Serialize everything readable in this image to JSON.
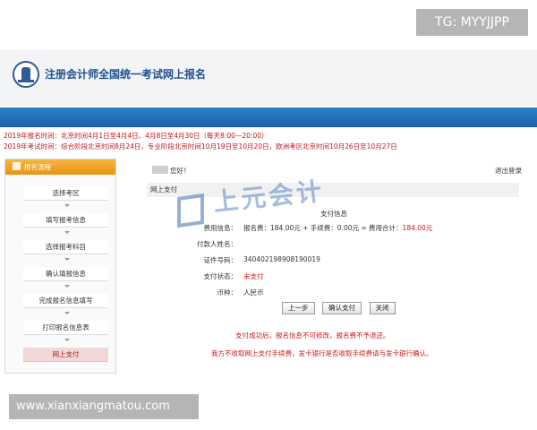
{
  "watermark_top": "TG: MYYJJPP",
  "watermark_bottom": "www.xianxiangmatou.com",
  "header": {
    "title": "注册会计师全国统一考试网上报名"
  },
  "notices": {
    "line1": "2019年报名时间：北京时间4月1日至4月4日、4月8日至4月30日（每天8:00—20:00）",
    "line2": "2019年考试时间：综合阶段北京时间8月24日，专业阶段北京时间10月19日至10月20日，欧洲考区北京时间10月26日至10月27日"
  },
  "sidebar": {
    "heading": "报名流程",
    "steps": [
      {
        "label": "选择考区",
        "active": false
      },
      {
        "label": "填写报考信息",
        "active": false
      },
      {
        "label": "选择报考科目",
        "active": false
      },
      {
        "label": "确认填报信息",
        "active": false
      },
      {
        "label": "完成报名信息填写",
        "active": false
      },
      {
        "label": "打印报名信息表",
        "active": false
      },
      {
        "label": "网上支付",
        "active": true
      }
    ]
  },
  "main": {
    "greeting": "您好！",
    "logout": "退出登录",
    "section": "网上支付",
    "pay_title": "支付信息",
    "fee_label": "费用信息：",
    "fee_text": "报名费：184.00元 + 手续费：0.00元 = 费用合计：",
    "fee_total": "184.00元",
    "payer_label": "付款人姓名：",
    "id_label": "证件号码：",
    "id_value": "340402198908190019",
    "status_label": "支付状态：",
    "status_value": "未支付",
    "currency_label": "币种：",
    "currency_value": "人民币",
    "buttons": {
      "prev": "上一步",
      "confirm": "确认支付",
      "close": "关闭"
    },
    "msg1": "支付成功后，报名信息不可修改，报名费不予退还。",
    "msg2": "我方不收取网上支付手续费，发卡银行是否收取手续费请与发卡银行确认。"
  },
  "brand_watermark": "上元会计",
  "colors": {
    "blue_bar": "#1b5fa8",
    "orange_head": "#e89414",
    "notice_red": "#c0161b",
    "active_step": "#f0d8d8"
  }
}
